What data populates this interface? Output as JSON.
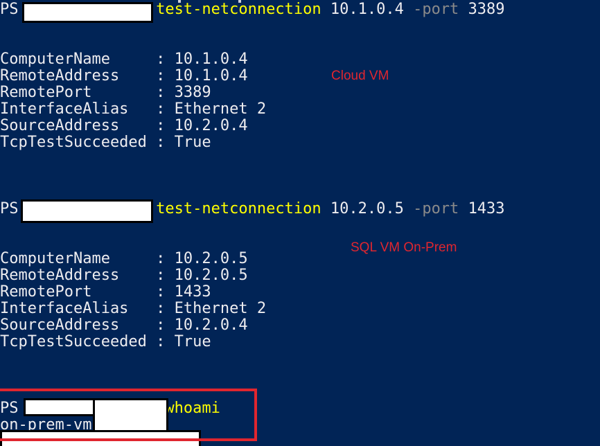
{
  "terminal": {
    "prompt_prefix": "PS",
    "prompt_suffix": ">",
    "colors": {
      "background": "#012456",
      "text": "#eeedf0",
      "command": "#ffff00",
      "parameter": "#8a8a8a",
      "annotation": "#e0262f",
      "redaction": "#ffffff"
    }
  },
  "block1": {
    "command": "test-netconnection",
    "args": "10.1.0.4",
    "param": "-port",
    "param_value": "3389",
    "annotation": "Cloud VM",
    "rows": [
      {
        "key": "ComputerName    ",
        "sep": " : ",
        "value": "10.1.0.4"
      },
      {
        "key": "RemoteAddress   ",
        "sep": " : ",
        "value": "10.1.0.4"
      },
      {
        "key": "RemotePort      ",
        "sep": " : ",
        "value": "3389"
      },
      {
        "key": "InterfaceAlias  ",
        "sep": " : ",
        "value": "Ethernet 2"
      },
      {
        "key": "SourceAddress   ",
        "sep": " : ",
        "value": "10.2.0.4"
      },
      {
        "key": "TcpTestSucceeded",
        "sep": " : ",
        "value": "True"
      }
    ]
  },
  "block2": {
    "command": "test-netconnection",
    "args": "10.2.0.5",
    "param": "-port",
    "param_value": "1433",
    "annotation": "SQL VM On-Prem",
    "rows": [
      {
        "key": "ComputerName    ",
        "sep": " : ",
        "value": "10.2.0.5"
      },
      {
        "key": "RemoteAddress   ",
        "sep": " : ",
        "value": "10.2.0.5"
      },
      {
        "key": "RemotePort      ",
        "sep": " : ",
        "value": "1433"
      },
      {
        "key": "InterfaceAlias  ",
        "sep": " : ",
        "value": "Ethernet 2"
      },
      {
        "key": "SourceAddress   ",
        "sep": " : ",
        "value": "10.2.0.4"
      },
      {
        "key": "TcpTestSucceeded",
        "sep": " : ",
        "value": "True"
      }
    ]
  },
  "block3": {
    "command": "whoami",
    "output_prefix": "on-prem-vm"
  }
}
